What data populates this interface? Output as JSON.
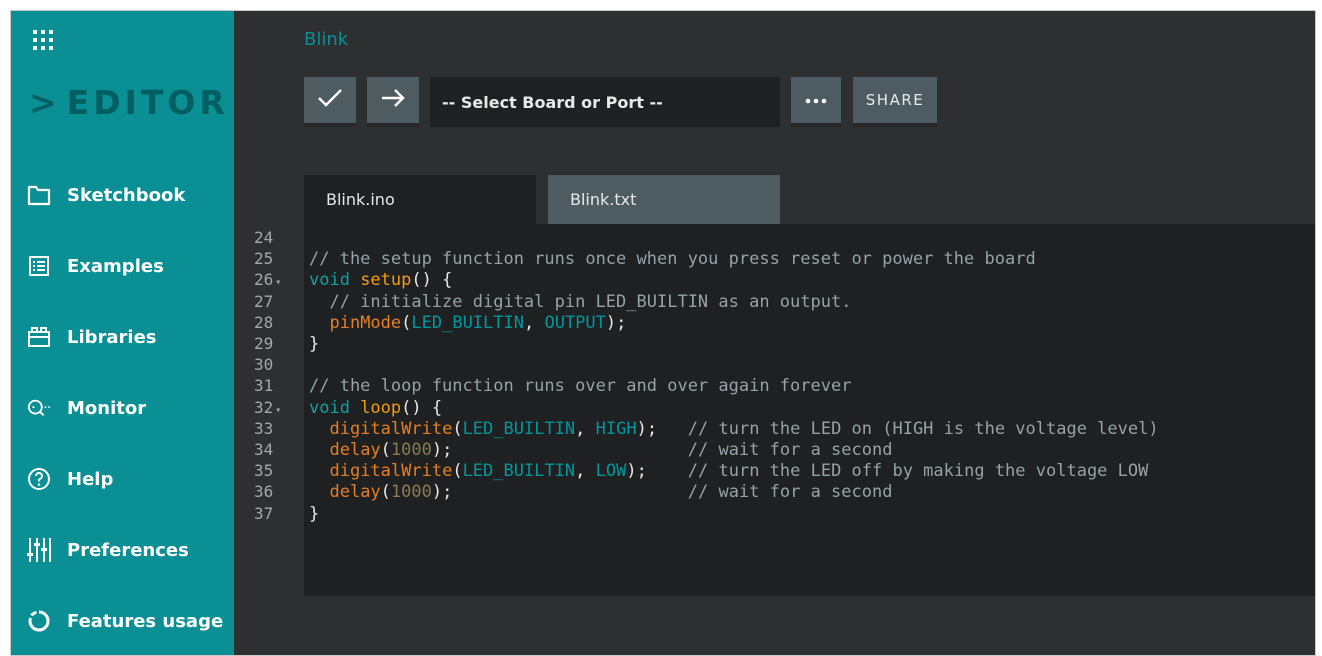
{
  "sidebar": {
    "brand": "EDITOR",
    "brand_chevron": ">",
    "items": [
      {
        "label": "Sketchbook",
        "icon": "folder-icon"
      },
      {
        "label": "Examples",
        "icon": "list-icon"
      },
      {
        "label": "Libraries",
        "icon": "library-icon"
      },
      {
        "label": "Monitor",
        "icon": "monitor-icon"
      },
      {
        "label": "Help",
        "icon": "help-icon"
      },
      {
        "label": "Preferences",
        "icon": "sliders-icon"
      },
      {
        "label": "Features usage",
        "icon": "usage-icon"
      }
    ]
  },
  "toolbar": {
    "sketch_name": "Blink",
    "verify_icon": "check-icon",
    "upload_icon": "arrow-right-icon",
    "board_select": "-- Select Board or Port --",
    "more_icon": "more-icon",
    "share_label": "SHARE"
  },
  "tabs": [
    {
      "label": "Blink.ino",
      "active": true
    },
    {
      "label": "Blink.txt",
      "active": false
    }
  ],
  "code": {
    "lines": [
      {
        "n": "24",
        "fold": false,
        "tokens": []
      },
      {
        "n": "25",
        "fold": false,
        "tokens": [
          [
            "com",
            "// the setup function runs once when you press reset or power the board"
          ]
        ]
      },
      {
        "n": "26",
        "fold": true,
        "tokens": [
          [
            "kw",
            "void "
          ],
          [
            "fn",
            "setup"
          ],
          [
            "plain",
            "() {"
          ]
        ]
      },
      {
        "n": "27",
        "fold": false,
        "tokens": [
          [
            "com",
            "  // initialize digital pin LED_BUILTIN as an output."
          ]
        ]
      },
      {
        "n": "28",
        "fold": false,
        "tokens": [
          [
            "plain",
            "  "
          ],
          [
            "call",
            "pinMode"
          ],
          [
            "plain",
            "("
          ],
          [
            "const",
            "LED_BUILTIN"
          ],
          [
            "plain",
            ", "
          ],
          [
            "const",
            "OUTPUT"
          ],
          [
            "plain",
            ");"
          ]
        ]
      },
      {
        "n": "29",
        "fold": false,
        "tokens": [
          [
            "plain",
            "}"
          ]
        ]
      },
      {
        "n": "30",
        "fold": false,
        "tokens": []
      },
      {
        "n": "31",
        "fold": false,
        "tokens": [
          [
            "com",
            "// the loop function runs over and over again forever"
          ]
        ]
      },
      {
        "n": "32",
        "fold": true,
        "tokens": [
          [
            "kw",
            "void "
          ],
          [
            "fn",
            "loop"
          ],
          [
            "plain",
            "() {"
          ]
        ]
      },
      {
        "n": "33",
        "fold": false,
        "tokens": [
          [
            "plain",
            "  "
          ],
          [
            "call",
            "digitalWrite"
          ],
          [
            "plain",
            "("
          ],
          [
            "const",
            "LED_BUILTIN"
          ],
          [
            "plain",
            ", "
          ],
          [
            "const",
            "HIGH"
          ],
          [
            "plain",
            ");   "
          ],
          [
            "com",
            "// turn the LED on (HIGH is the voltage level)"
          ]
        ]
      },
      {
        "n": "34",
        "fold": false,
        "tokens": [
          [
            "plain",
            "  "
          ],
          [
            "call",
            "delay"
          ],
          [
            "plain",
            "("
          ],
          [
            "num",
            "1000"
          ],
          [
            "plain",
            ");                       "
          ],
          [
            "com",
            "// wait for a second"
          ]
        ]
      },
      {
        "n": "35",
        "fold": false,
        "tokens": [
          [
            "plain",
            "  "
          ],
          [
            "call",
            "digitalWrite"
          ],
          [
            "plain",
            "("
          ],
          [
            "const",
            "LED_BUILTIN"
          ],
          [
            "plain",
            ", "
          ],
          [
            "const",
            "LOW"
          ],
          [
            "plain",
            ");    "
          ],
          [
            "com",
            "// turn the LED off by making the voltage LOW"
          ]
        ]
      },
      {
        "n": "36",
        "fold": false,
        "tokens": [
          [
            "plain",
            "  "
          ],
          [
            "call",
            "delay"
          ],
          [
            "plain",
            "("
          ],
          [
            "num",
            "1000"
          ],
          [
            "plain",
            ");                       "
          ],
          [
            "com",
            "// wait for a second"
          ]
        ]
      },
      {
        "n": "37",
        "fold": false,
        "tokens": [
          [
            "plain",
            "}"
          ]
        ]
      }
    ]
  },
  "colors": {
    "sidebar_bg": "#0a8f95",
    "brand": "#005f63",
    "main_bg": "#2d2f31",
    "editor_bg": "#1e2021",
    "button_bg": "#4e5b61",
    "accent_title": "#0a8f95"
  }
}
